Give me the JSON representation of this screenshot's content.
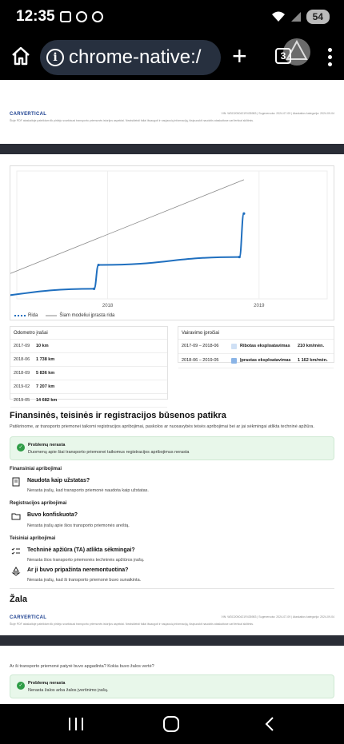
{
  "status_bar": {
    "time": "12:35",
    "battery": "54"
  },
  "browser": {
    "url": "chrome-native:/",
    "tabs_count": "3"
  },
  "pdf_header": {
    "logo_main": "CARVERTICAL",
    "meta": "VIN: WDD2050421R435983 | Sugeneruota: 2024-07-09 | Ataskaitos kategorija: 2024-09-04",
    "disclaimer": "Šioje PDF ataskaitoje pateiktam tik pirkėjo svarbiausi transporto priemonės istorijos aspektai. Neatskleisti failai išsaugoti ir naujausią informaciją, išsipuoskit naudotis ataskaitose carVertical skiltimis."
  },
  "chart_data": {
    "type": "line",
    "x_ticks": [
      "2018",
      "2019"
    ],
    "series": [
      {
        "name": "Rida",
        "color": "#1f6fbf",
        "style": "solid-dotted",
        "points": [
          [
            2017.09,
            10
          ],
          [
            2018.06,
            1738
          ],
          [
            2018.09,
            5836
          ],
          [
            2019.02,
            7207
          ],
          [
            2019.05,
            14682
          ]
        ]
      },
      {
        "name": "Šiam modeliui įprasta rida",
        "color": "#8a8a8a",
        "style": "line",
        "points": [
          [
            2017.09,
            10
          ],
          [
            2019.05,
            20500
          ]
        ]
      }
    ],
    "grid": true,
    "legend": "bottom-left"
  },
  "odometer": {
    "title": "Odometro įrašai",
    "rows": [
      {
        "date": "2017-09",
        "value": "10 km"
      },
      {
        "date": "2018-06",
        "value": "1 738 km"
      },
      {
        "date": "2018-09",
        "value": "5 836 km"
      },
      {
        "date": "2019-02",
        "value": "7 207 km"
      },
      {
        "date": "2019-05",
        "value": "14 682 km"
      }
    ]
  },
  "usage": {
    "title": "Vairavimo įpročiai",
    "rows": [
      {
        "period": "2017-09 – 2018-06",
        "label": "Ribotas eksploatavimas",
        "value": "210 km/mėn.",
        "color": "#cfe0f5"
      },
      {
        "period": "2018-06 – 2019-05",
        "label": "Įprastas eksploatavimas",
        "value": "1 162 km/mėn.",
        "color": "#8ab4e6"
      }
    ]
  },
  "finance": {
    "title": "Finansinės, teisinės ir registracijos būsenos patikra",
    "description": "Patikrinome, ar transporto priemonei taikomi registracijos apribojimai, paskolos ar nuosavybės teisės apribojimai bei ar jai sėkmingai atlikta techninė apžiūra.",
    "ok_title": "Problemų nerasta",
    "ok_text": "Duomenų apie šiai transporto priemonei taikomus registracijos apribojimus nerasta",
    "sec_financial": "Finansiniai apribojimai",
    "q1": "Naudota kaip užstatas?",
    "a1": "Nerasta įrašų, kad transporto priemonė naudota kaip užstatas.",
    "sec_registration": "Registracijos apribojimai",
    "q2": "Buvo konfiskuota?",
    "a2": "Nerasta įrašų apie šios transporto priemonės areštą.",
    "sec_legal": "Teisiniai apribojimai",
    "q3": "Techninė apžiūra (TA) atlikta sėkmingai?",
    "a3": "Nerasta šios transporto priemonės techninės apžiūros įrašų.",
    "q4": "Ar ji buvo pripažinta neremontuotina?",
    "a4": "Nerasta įrašų, kad ši transporto priemonė buvo sunaikinta."
  },
  "damage": {
    "title": "Žala",
    "question": "Ar ši transporto priemonė patyrė buvo apgadinta? Kokia buvo žalos vertė?",
    "ok_title": "Problemų nerasta",
    "ok_text": "Nerasta žalos arba žalos įvertinimo įrašų."
  }
}
